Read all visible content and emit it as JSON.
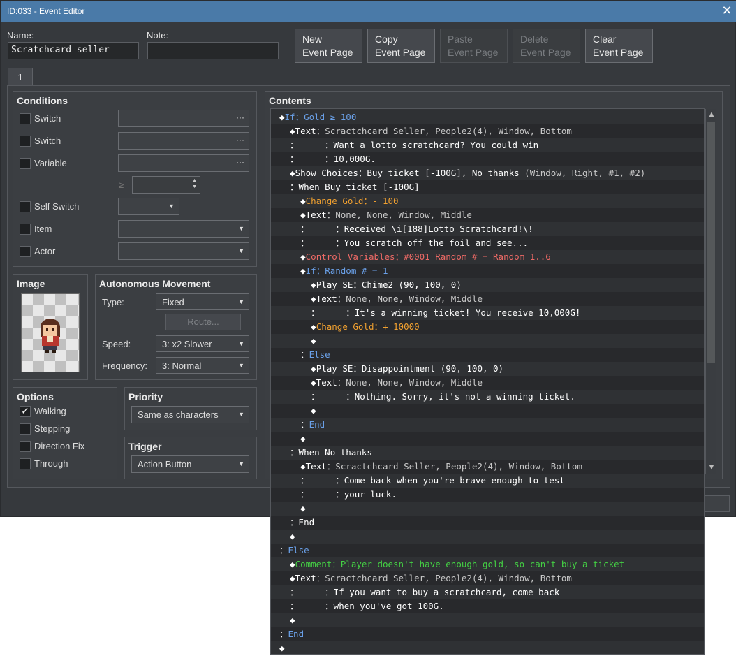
{
  "window": {
    "title": "ID:033 - Event Editor",
    "close": "✕"
  },
  "header": {
    "name_label": "Name:",
    "name_value": "Scratchcard seller",
    "note_label": "Note:",
    "note_value": "",
    "buttons": [
      {
        "line1": "New",
        "line2": "Event Page",
        "enabled": true
      },
      {
        "line1": "Copy",
        "line2": "Event Page",
        "enabled": true
      },
      {
        "line1": "Paste",
        "line2": "Event Page",
        "enabled": false
      },
      {
        "line1": "Delete",
        "line2": "Event Page",
        "enabled": false
      },
      {
        "line1": "Clear",
        "line2": "Event Page",
        "enabled": true
      }
    ]
  },
  "tabs": [
    "1"
  ],
  "conditions": {
    "title": "Conditions",
    "rows": [
      {
        "label": "Switch",
        "checked": false
      },
      {
        "label": "Switch",
        "checked": false
      },
      {
        "label": "Variable",
        "checked": false
      },
      {
        "label": "Self Switch",
        "checked": false
      },
      {
        "label": "Item",
        "checked": false
      },
      {
        "label": "Actor",
        "checked": false
      }
    ],
    "gte": "≥"
  },
  "image": {
    "title": "Image"
  },
  "movement": {
    "title": "Autonomous Movement",
    "type_label": "Type:",
    "type_value": "Fixed",
    "route_label": "Route...",
    "speed_label": "Speed:",
    "speed_value": "3: x2 Slower",
    "freq_label": "Frequency:",
    "freq_value": "3: Normal"
  },
  "options": {
    "title": "Options",
    "items": [
      {
        "label": "Walking",
        "checked": true
      },
      {
        "label": "Stepping",
        "checked": false
      },
      {
        "label": "Direction Fix",
        "checked": false
      },
      {
        "label": "Through",
        "checked": false
      }
    ]
  },
  "priority": {
    "title": "Priority",
    "value": "Same as characters"
  },
  "trigger": {
    "title": "Trigger",
    "value": "Action Button"
  },
  "contents": {
    "title": "Contents",
    "lines": [
      [
        {
          "t": "◆",
          "c": "white"
        },
        {
          "t": "If",
          "c": "blue"
        },
        {
          "t": "：Gold ≥ 100",
          "c": "blue"
        }
      ],
      [
        {
          "t": "  ◆",
          "c": "white"
        },
        {
          "t": "Text",
          "c": "white"
        },
        {
          "t": "：Scractchcard Seller, People2(4), Window, Bottom",
          "c": "gray"
        }
      ],
      [
        {
          "t": "  ：     ：Want a lotto scratchcard? You could win",
          "c": "white"
        }
      ],
      [
        {
          "t": "  ：     ：10,000G.",
          "c": "white"
        }
      ],
      [
        {
          "t": "  ◆",
          "c": "white"
        },
        {
          "t": "Show Choices",
          "c": "white"
        },
        {
          "t": "：Buy ticket [-100G], No thanks",
          "c": "white"
        },
        {
          "t": " (Window, Right, #1, #2)",
          "c": "gray"
        }
      ],
      [
        {
          "t": "  ：When Buy ticket [-100G]",
          "c": "white"
        }
      ],
      [
        {
          "t": "    ◆",
          "c": "white"
        },
        {
          "t": "Change Gold",
          "c": "orange"
        },
        {
          "t": "：- 100",
          "c": "orange"
        }
      ],
      [
        {
          "t": "    ◆",
          "c": "white"
        },
        {
          "t": "Text",
          "c": "white"
        },
        {
          "t": "：None, None, Window, Middle",
          "c": "gray"
        }
      ],
      [
        {
          "t": "    ：     ：Received \\i[188]Lotto Scratchcard!\\!",
          "c": "white"
        }
      ],
      [
        {
          "t": "    ：     ：You scratch off the foil and see...",
          "c": "white"
        }
      ],
      [
        {
          "t": "    ◆",
          "c": "white"
        },
        {
          "t": "Control Variables",
          "c": "red"
        },
        {
          "t": "：#0001 Random # = Random 1..6",
          "c": "red"
        }
      ],
      [
        {
          "t": "    ◆",
          "c": "white"
        },
        {
          "t": "If",
          "c": "blue"
        },
        {
          "t": "：Random # = 1",
          "c": "blue"
        }
      ],
      [
        {
          "t": "      ◆",
          "c": "white"
        },
        {
          "t": "Play SE",
          "c": "white"
        },
        {
          "t": "：Chime2 (90, 100, 0)",
          "c": "white"
        }
      ],
      [
        {
          "t": "      ◆",
          "c": "white"
        },
        {
          "t": "Text",
          "c": "white"
        },
        {
          "t": "：None, None, Window, Middle",
          "c": "gray"
        }
      ],
      [
        {
          "t": "      ：     ：It's a winning ticket! You receive 10,000G!",
          "c": "white"
        }
      ],
      [
        {
          "t": "      ◆",
          "c": "white"
        },
        {
          "t": "Change Gold",
          "c": "orange"
        },
        {
          "t": "：+ 10000",
          "c": "orange"
        }
      ],
      [
        {
          "t": "      ◆",
          "c": "white"
        }
      ],
      [
        {
          "t": "    ：",
          "c": "white"
        },
        {
          "t": "Else",
          "c": "blue"
        }
      ],
      [
        {
          "t": "      ◆",
          "c": "white"
        },
        {
          "t": "Play SE",
          "c": "white"
        },
        {
          "t": "：Disappointment (90, 100, 0)",
          "c": "white"
        }
      ],
      [
        {
          "t": "      ◆",
          "c": "white"
        },
        {
          "t": "Text",
          "c": "white"
        },
        {
          "t": "：None, None, Window, Middle",
          "c": "gray"
        }
      ],
      [
        {
          "t": "      ：     ：Nothing. Sorry, it's not a winning ticket.",
          "c": "white"
        }
      ],
      [
        {
          "t": "      ◆",
          "c": "white"
        }
      ],
      [
        {
          "t": "    ：",
          "c": "white"
        },
        {
          "t": "End",
          "c": "blue"
        }
      ],
      [
        {
          "t": "    ◆",
          "c": "white"
        }
      ],
      [
        {
          "t": "  ：When No thanks",
          "c": "white"
        }
      ],
      [
        {
          "t": "    ◆",
          "c": "white"
        },
        {
          "t": "Text",
          "c": "white"
        },
        {
          "t": "：Scractchcard Seller, People2(4), Window, Bottom",
          "c": "gray"
        }
      ],
      [
        {
          "t": "    ：     ：Come back when you're brave enough to test",
          "c": "white"
        }
      ],
      [
        {
          "t": "    ：     ：your luck.",
          "c": "white"
        }
      ],
      [
        {
          "t": "    ◆",
          "c": "white"
        }
      ],
      [
        {
          "t": "  ：End",
          "c": "white"
        }
      ],
      [
        {
          "t": "  ◆",
          "c": "white"
        }
      ],
      [
        {
          "t": "：",
          "c": "white"
        },
        {
          "t": "Else",
          "c": "blue"
        }
      ],
      [
        {
          "t": "  ◆",
          "c": "white"
        },
        {
          "t": "Comment",
          "c": "green"
        },
        {
          "t": "：Player doesn't have enough gold, so can't buy a ticket",
          "c": "green"
        }
      ],
      [
        {
          "t": "  ◆",
          "c": "white"
        },
        {
          "t": "Text",
          "c": "white"
        },
        {
          "t": "：Scractchcard Seller, People2(4), Window, Bottom",
          "c": "gray"
        }
      ],
      [
        {
          "t": "  ：     ：If you want to buy a scratchcard, come back",
          "c": "white"
        }
      ],
      [
        {
          "t": "  ：     ：when you've got 100G.",
          "c": "white"
        }
      ],
      [
        {
          "t": "  ◆",
          "c": "white"
        }
      ],
      [
        {
          "t": "：",
          "c": "white"
        },
        {
          "t": "End",
          "c": "blue"
        }
      ],
      [
        {
          "t": "◆",
          "c": "white"
        }
      ]
    ]
  }
}
